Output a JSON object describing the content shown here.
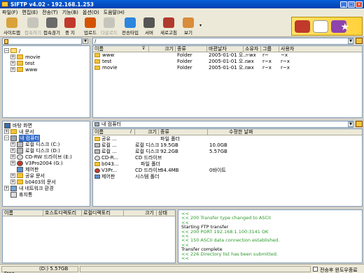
{
  "window": {
    "title": "SIFTP v4.02 - 192.168.1.253"
  },
  "menu": [
    "파일(F)",
    "편집(E)",
    "전송(T)",
    "기능(B)",
    "옵션(O)",
    "도움말(H)"
  ],
  "toolbar": [
    {
      "label": "사이트맵",
      "color": "#d9a23a",
      "enabled": true
    },
    {
      "label": "접속하기",
      "color": "#9a9a9a",
      "enabled": false
    },
    {
      "label": "접속끊기",
      "color": "#6a6a6a",
      "enabled": true
    },
    {
      "label": "중 지",
      "color": "#c0392b",
      "enabled": true
    },
    {
      "label": "업로드",
      "color": "#d35400",
      "enabled": true
    },
    {
      "label": "다운로드",
      "color": "#9a9a9a",
      "enabled": false
    },
    {
      "label": "전송타입",
      "color": "#2e86de",
      "enabled": true
    },
    {
      "label": "서버",
      "color": "#555555",
      "enabled": true
    },
    {
      "label": "새로고침",
      "color": "#b03a2e",
      "enabled": true
    },
    {
      "label": "보기",
      "color": "#d98c3a",
      "enabled": true
    }
  ],
  "remote": {
    "path": "/",
    "tree": [
      {
        "label": "/",
        "level": 0
      },
      {
        "label": "movie",
        "level": 1
      },
      {
        "label": "test",
        "level": 1
      },
      {
        "label": "www",
        "level": 1
      }
    ],
    "columns": [
      "이름",
      "크기",
      "종류",
      "바뀐날자",
      "소유자",
      "그룹",
      "사용자"
    ],
    "files": [
      {
        "name": "www",
        "size": "",
        "type": "Folder",
        "date": "2005-01-01 오...",
        "owner": "~wx",
        "group": "r~",
        "user": "~x"
      },
      {
        "name": "test",
        "size": "",
        "type": "Folder",
        "date": "2005-01-01 오...",
        "owner": "rwx",
        "group": "r~x",
        "user": "r~x"
      },
      {
        "name": "movie",
        "size": "",
        "type": "Folder",
        "date": "2005-01-01 오...",
        "owner": "rwx",
        "group": "r~x",
        "user": "r~x"
      }
    ]
  },
  "local": {
    "path": "내 컴퓨터",
    "tree": [
      {
        "label": "바탕 화면",
        "level": 0
      },
      {
        "label": "내 문서",
        "level": 1
      },
      {
        "label": "내 컴퓨터",
        "level": 1,
        "selected": true
      },
      {
        "label": "로컬 디스크 (C:)",
        "level": 2
      },
      {
        "label": "로컬 디스크 (D:)",
        "level": 2
      },
      {
        "label": "CD-RW 드라이브 (E:)",
        "level": 2
      },
      {
        "label": "V3Pro2004 (G:)",
        "level": 2
      },
      {
        "label": "제어판",
        "level": 2
      },
      {
        "label": "공유 문서",
        "level": 2
      },
      {
        "label": "b0403의 문서",
        "level": 2
      },
      {
        "label": "내 네트워크 환경",
        "level": 1
      },
      {
        "label": "휴지통",
        "level": 1
      }
    ],
    "columns": [
      "이름",
      "크기",
      "종류",
      "수정한 날짜"
    ],
    "files": [
      {
        "name": "공유 ...",
        "size": "",
        "type": "파일 폴더",
        "free": ""
      },
      {
        "name": "로컬 ...",
        "size": "로컬 디스크",
        "type": "19.5GB",
        "free": "10.0GB"
      },
      {
        "name": "로컬 ...",
        "size": "로컬 디스크",
        "type": "92.2GB",
        "free": "5.57GB"
      },
      {
        "name": "CD-R...",
        "size": "CD 드라이브",
        "type": "",
        "free": ""
      },
      {
        "name": "b043...",
        "size": "파일 폴더",
        "type": "",
        "free": ""
      },
      {
        "name": "V3Pr...",
        "size": "CD 드라이브",
        "type": "34.4MB",
        "free": "0바이트"
      },
      {
        "name": "제어판",
        "size": "시스템 폴더",
        "type": "",
        "free": ""
      }
    ]
  },
  "queue": {
    "columns": [
      "이름",
      "호스트디렉토리",
      "로컬디렉토리",
      "크기",
      "상태"
    ]
  },
  "log": [
    {
      "text": "<<",
      "green": true
    },
    {
      "text": "<< 200 Transfer type changed to ASCII",
      "green": true
    },
    {
      "text": "<<",
      "green": true
    },
    {
      "text": "Starting FTP transfer",
      "green": false
    },
    {
      "text": "<< 200 PORT 192.168.1.100:3141 OK",
      "green": true
    },
    {
      "text": "<<",
      "green": true
    },
    {
      "text": "<< 150 ASCII data connection established.",
      "green": true
    },
    {
      "text": "<<",
      "green": true
    },
    {
      "text": "Transfer complete",
      "green": false
    },
    {
      "text": "<< 226 Directory list has been submitted.",
      "green": true
    },
    {
      "text": "<<",
      "green": true
    }
  ],
  "status": {
    "drive": "(D:)  5.57GB Free",
    "exit_after": "전송후 윈도우종료"
  }
}
